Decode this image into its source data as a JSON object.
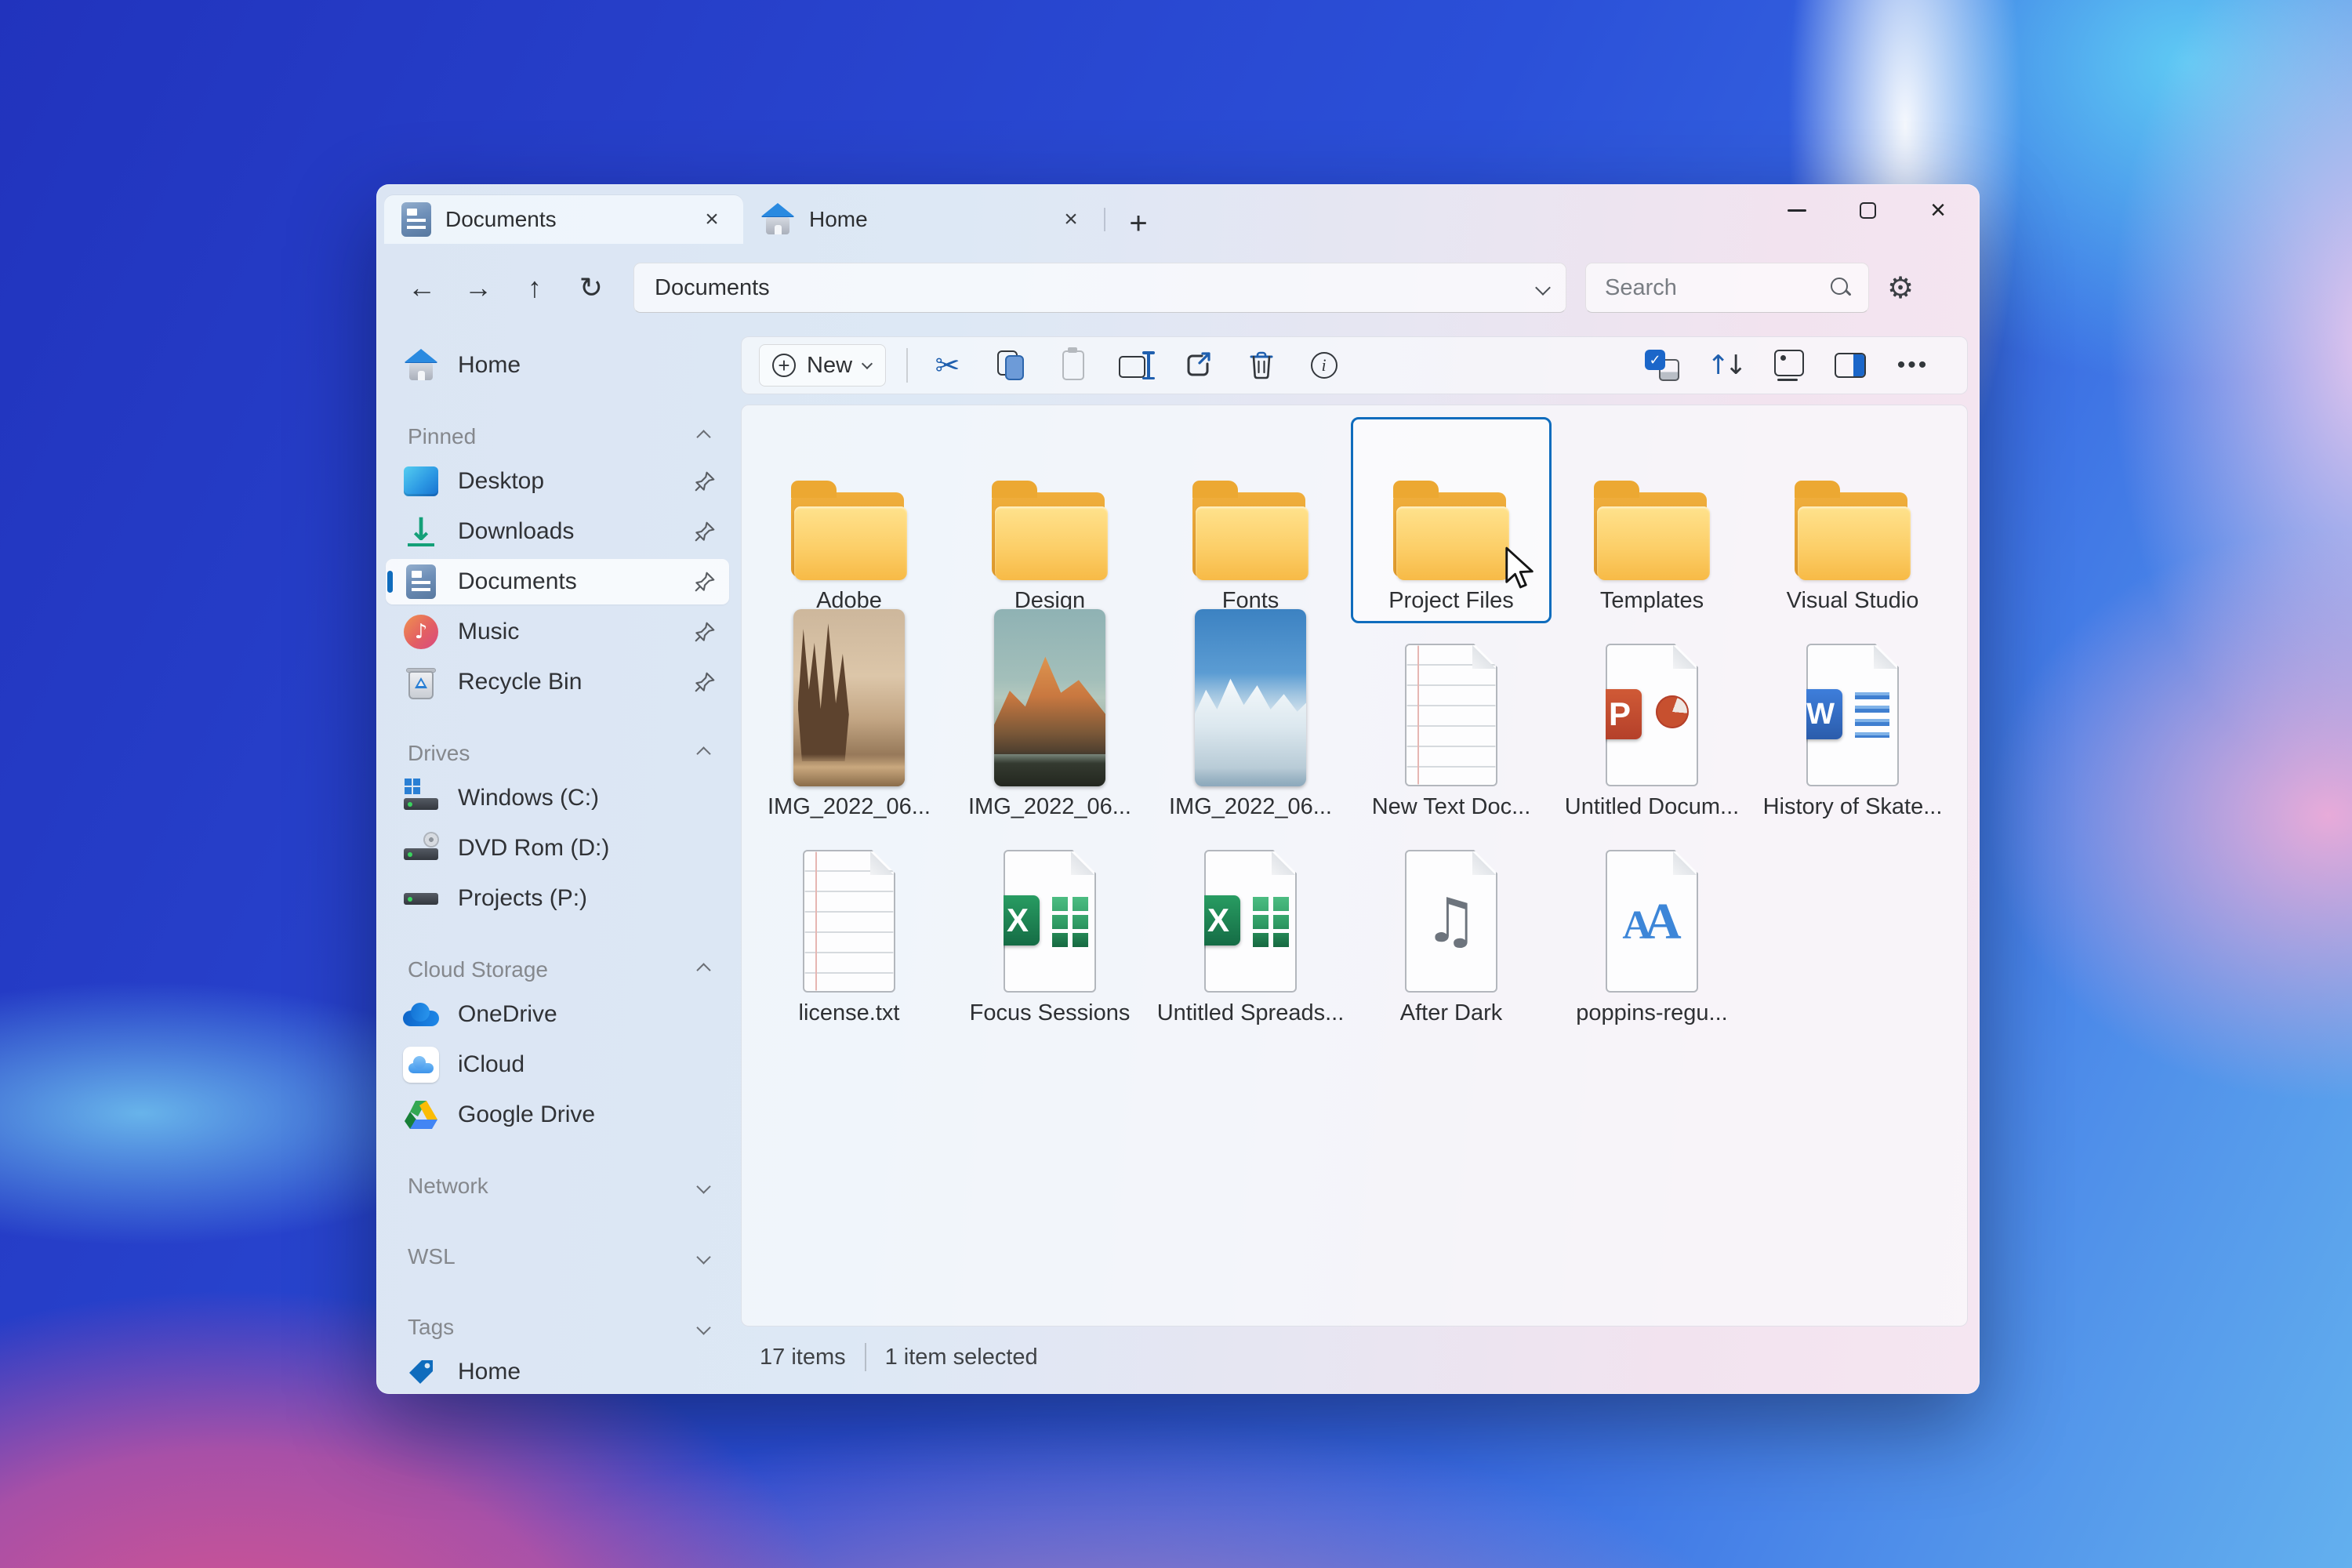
{
  "window": {
    "tab_bar": {
      "tabs": [
        {
          "label": "Documents"
        },
        {
          "label": "Home"
        }
      ],
      "close_glyph": "×",
      "new_tab_glyph": "+"
    },
    "navbar": {
      "back_glyph": "←",
      "forward_glyph": "→",
      "up_glyph": "↑",
      "refresh_glyph": "↻",
      "address": "Documents",
      "search": "Search",
      "settings_glyph": "⚙"
    },
    "sidebar": {
      "home": {
        "label": "Home"
      },
      "sections": [
        {
          "header": "Pinned",
          "items": [
            {
              "label": "Desktop"
            },
            {
              "label": "Downloads"
            },
            {
              "label": "Documents"
            },
            {
              "label": "Music"
            },
            {
              "label": "Recycle Bin"
            }
          ]
        },
        {
          "header": "Drives",
          "items": [
            {
              "label": "Windows (C:)"
            },
            {
              "label": "DVD Rom (D:)"
            },
            {
              "label": "Projects (P:)"
            }
          ]
        },
        {
          "header": "Cloud Storage",
          "items": [
            {
              "label": "OneDrive"
            },
            {
              "label": "iCloud"
            },
            {
              "label": "Google Drive"
            }
          ]
        },
        {
          "header": "Network"
        },
        {
          "header": "WSL"
        },
        {
          "header": "Tags"
        }
      ],
      "tag_home": {
        "label": "Home"
      }
    },
    "toolbar": {
      "new_label": "New",
      "cut_glyph": "✂",
      "info_glyph": "i",
      "sort_up_glyph": "↑",
      "sort_down_glyph": "↓",
      "more_glyph": "•••",
      "download_glyph": "↓",
      "music_glyph": "♪",
      "audio_note_glyph": "♫"
    },
    "files": {
      "items": [
        {
          "name": "Adobe",
          "type": "folder"
        },
        {
          "name": "Design",
          "type": "folder"
        },
        {
          "name": "Fonts",
          "type": "folder"
        },
        {
          "name": "Project Files",
          "type": "folder",
          "selected": true
        },
        {
          "name": "Templates",
          "type": "folder"
        },
        {
          "name": "Visual Studio",
          "type": "folder"
        },
        {
          "name": "IMG_2022_06...",
          "type": "image"
        },
        {
          "name": "IMG_2022_06...",
          "type": "image"
        },
        {
          "name": "IMG_2022_06...",
          "type": "image"
        },
        {
          "name": "New Text Doc...",
          "type": "text-document"
        },
        {
          "name": "Untitled Docum...",
          "type": "powerpoint"
        },
        {
          "name": "History of Skate...",
          "type": "word"
        },
        {
          "name": "license.txt",
          "type": "text-document"
        },
        {
          "name": "Focus Sessions",
          "type": "excel"
        },
        {
          "name": "Untitled Spreads...",
          "type": "excel"
        },
        {
          "name": "After Dark",
          "type": "audio"
        },
        {
          "name": "poppins-regu...",
          "type": "font-file"
        }
      ]
    },
    "statusbar": {
      "count": "17 items",
      "selected": "1 item selected"
    }
  },
  "colors": {
    "accent": "#0f6cbd",
    "folder_yellow": "#f7ba46",
    "excel_green": "#2e9a63",
    "word_blue": "#3e7edb",
    "powerpoint_orange": "#c7502f"
  }
}
